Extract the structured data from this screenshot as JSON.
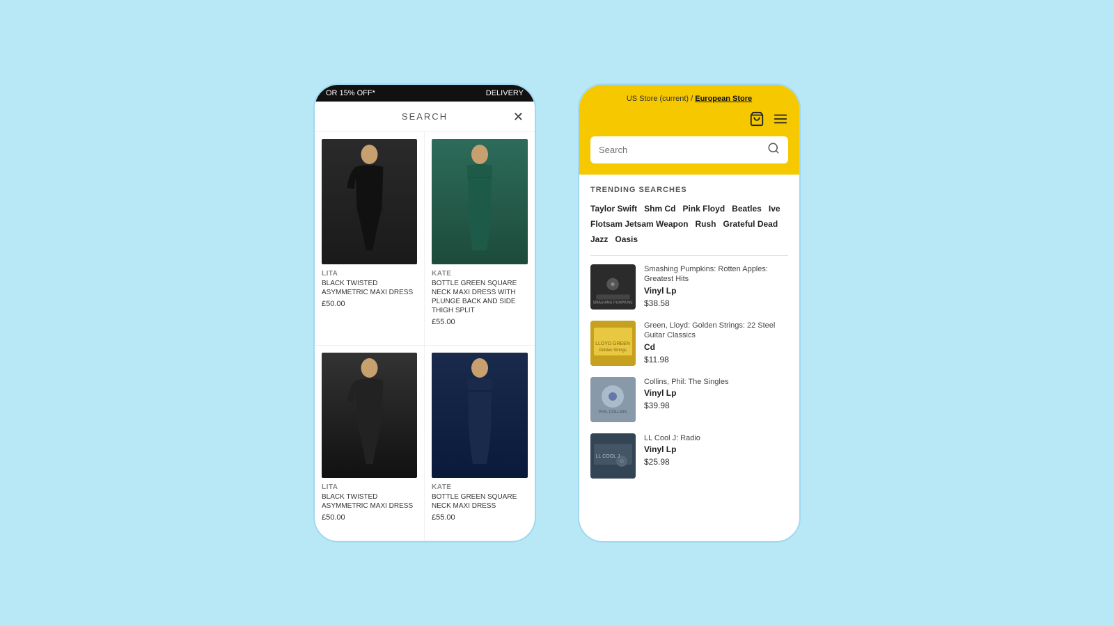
{
  "left_phone": {
    "banner": {
      "promo": "OR 15% OFF*",
      "delivery": "DELIVERY"
    },
    "search": {
      "title": "SEARCH",
      "close_label": "✕"
    },
    "products": [
      {
        "brand": "LITA",
        "name": "BLACK TWISTED ASYMMETRIC MAXI DRESS",
        "price": "£50.00",
        "color_class": "dress-black-asym"
      },
      {
        "brand": "KATE",
        "name": "BOTTLE GREEN SQUARE NECK MAXI DRESS WITH PLUNGE BACK AND SIDE THIGH SPLIT",
        "price": "£55.00",
        "color_class": "dress-green-square"
      },
      {
        "brand": "LITA",
        "name": "BLACK TWISTED ASYMMETRIC MAXI DRESS",
        "price": "£50.00",
        "color_class": "dress-black-asym2"
      },
      {
        "brand": "KATE",
        "name": "BOTTLE GREEN SQUARE NECK MAXI DRESS",
        "price": "£55.00",
        "color_class": "dress-navy-square"
      }
    ]
  },
  "right_phone": {
    "store_nav": {
      "text": "US Store (current) / ",
      "link": "European Store"
    },
    "search_placeholder": "Search",
    "trending": {
      "title": "TRENDING SEARCHES",
      "tags": [
        "Taylor Swift",
        "Shm Cd",
        "Pink Floyd",
        "Beatles",
        "Ive",
        "Flotsam Jetsam Weapon",
        "Rush",
        "Grateful Dead",
        "Jazz",
        "Oasis"
      ]
    },
    "results": [
      {
        "name": "Smashing Pumpkins: Rotten Apples: Greatest Hits",
        "type": "Vinyl Lp",
        "price": "$38.58",
        "thumb_class": "album-art-1"
      },
      {
        "name": "Green, Lloyd: Golden Strings: 22 Steel Guitar Classics",
        "type": "Cd",
        "price": "$11.98",
        "thumb_class": "album-art-2"
      },
      {
        "name": "Collins, Phil: The Singles",
        "type": "Vinyl Lp",
        "price": "$39.98",
        "thumb_class": "album-art-3"
      },
      {
        "name": "LL Cool J: Radio",
        "type": "Vinyl Lp",
        "price": "$25.98",
        "thumb_class": "album-art-4"
      }
    ]
  }
}
